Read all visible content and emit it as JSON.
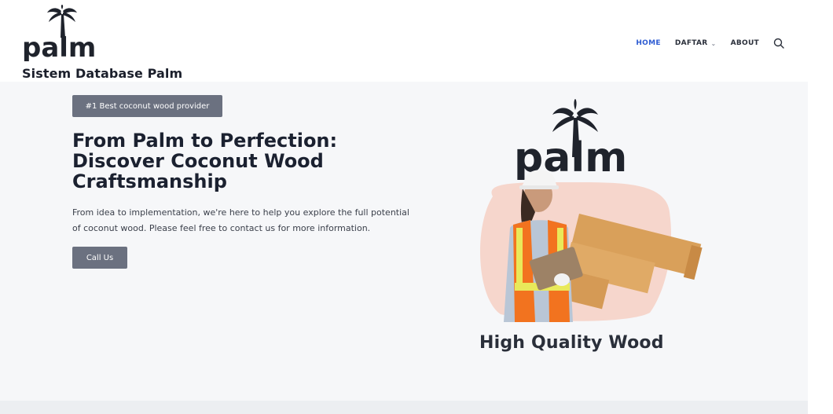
{
  "brand": {
    "logo_text": "palm",
    "site_title": "Sistem Database Palm"
  },
  "nav": {
    "items": [
      {
        "label": "HOME",
        "active": true
      },
      {
        "label": "DAFTAR",
        "has_dropdown": true
      },
      {
        "label": "ABOUT"
      }
    ],
    "search_icon": "search-icon"
  },
  "hero": {
    "badge": "#1 Best coconut wood provider",
    "title": "From Palm to Perfection: Discover Coconut Wood Craftsmanship",
    "text": "From idea to implementation, we're here to help you explore the full potential of coconut wood. Please feel free to contact us for more information.",
    "cta_label": "Call Us",
    "image_logo_text": "palm",
    "image_caption": "High Quality Wood"
  },
  "colors": {
    "accent_nav": "#2d5bd2",
    "button_bg": "#6b7180",
    "hero_bg": "#f6f7f9",
    "text_dark": "#1b2130"
  }
}
